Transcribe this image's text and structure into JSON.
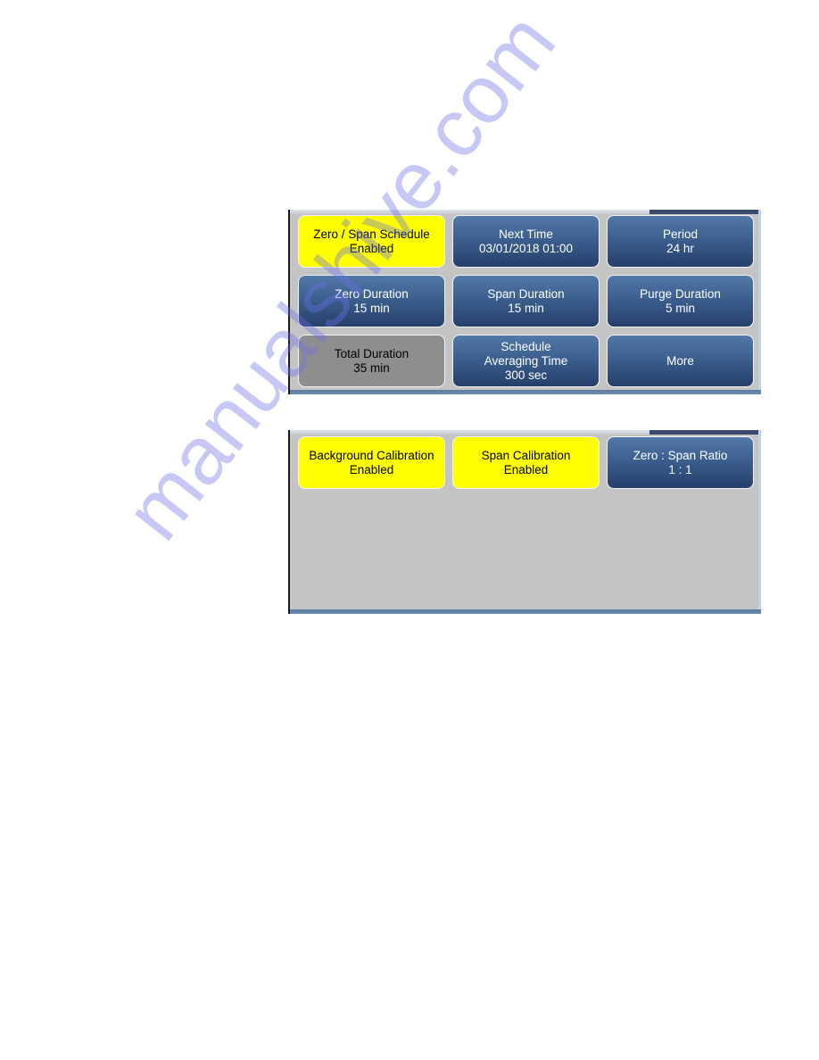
{
  "screen1": {
    "buttons": [
      {
        "line1": "Zero / Span Schedule",
        "line2": "Enabled",
        "style": "yellow"
      },
      {
        "line1": "Next Time",
        "line2": "03/01/2018 01:00",
        "style": "blue"
      },
      {
        "line1": "Period",
        "line2": "24 hr",
        "style": "blue"
      },
      {
        "line1": "Zero Duration",
        "line2": "15 min",
        "style": "blue"
      },
      {
        "line1": "Span Duration",
        "line2": "15 min",
        "style": "blue"
      },
      {
        "line1": "Purge Duration",
        "line2": "5 min",
        "style": "blue"
      },
      {
        "line1": "Total Duration",
        "line2": "35 min",
        "style": "gray"
      },
      {
        "line1": "Schedule",
        "line2": "Averaging Time",
        "line3": "300 sec",
        "style": "blue"
      },
      {
        "line1": "More",
        "style": "blue"
      }
    ]
  },
  "screen2": {
    "buttons": [
      {
        "line1": "Background Calibration",
        "line2": "Enabled",
        "style": "yellow"
      },
      {
        "line1": "Span Calibration",
        "line2": "Enabled",
        "style": "yellow"
      },
      {
        "line1": "Zero : Span Ratio",
        "line2": "1 : 1",
        "style": "blue"
      }
    ]
  },
  "colors": {
    "enabled_yellow": "#ffff00",
    "button_blue": "#3c5f8f",
    "readonly_gray": "#8e8e8e",
    "panel_bg": "#c4c4c4"
  },
  "watermark": "manualshive.com"
}
